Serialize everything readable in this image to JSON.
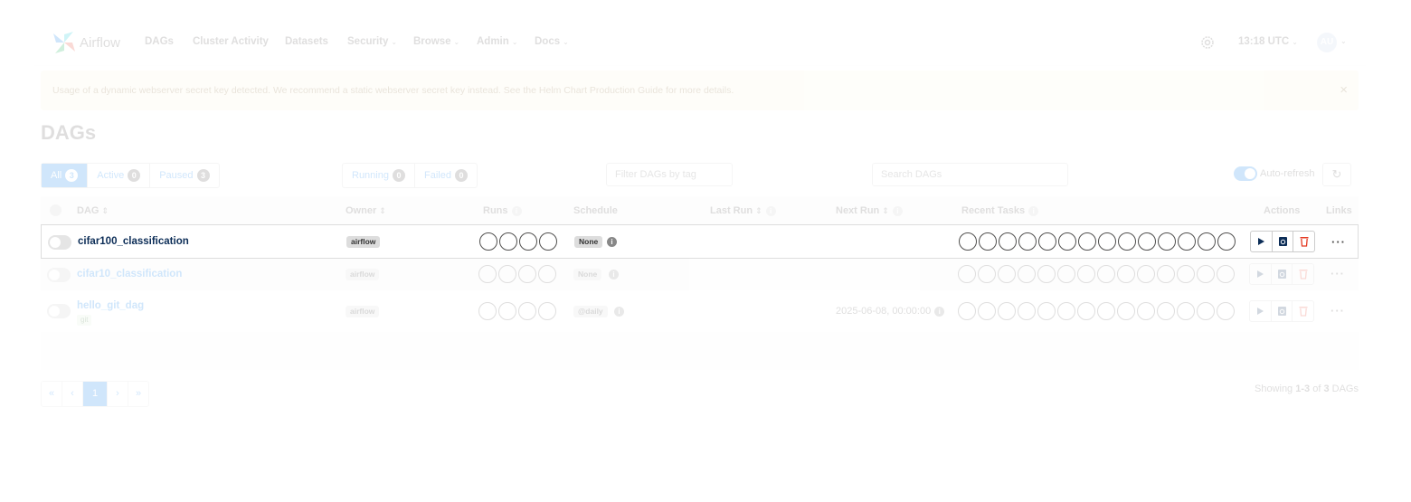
{
  "navbar": {
    "brand": "Airflow",
    "items": [
      {
        "label": "DAGs",
        "dropdown": false
      },
      {
        "label": "Cluster Activity",
        "dropdown": false
      },
      {
        "label": "Datasets",
        "dropdown": false
      },
      {
        "label": "Security",
        "dropdown": true
      },
      {
        "label": "Browse",
        "dropdown": true
      },
      {
        "label": "Admin",
        "dropdown": true
      },
      {
        "label": "Docs",
        "dropdown": true
      }
    ],
    "time": "13:18 UTC",
    "avatar": "AU"
  },
  "alert": {
    "text": "Usage of a dynamic webserver secret key detected. We recommend a static webserver secret key instead. See the Helm Chart Production Guide for more details.",
    "close": "×"
  },
  "page_title": "DAGs",
  "filters": {
    "status": [
      {
        "label": "All",
        "count": "3"
      },
      {
        "label": "Active",
        "count": "0"
      },
      {
        "label": "Paused",
        "count": "3"
      }
    ],
    "runs": [
      {
        "label": "Running",
        "count": "0"
      },
      {
        "label": "Failed",
        "count": "0"
      }
    ],
    "tag_placeholder": "Filter DAGs by tag",
    "search_placeholder": "Search DAGs",
    "auto_refresh": "Auto-refresh",
    "refresh_icon": "↻"
  },
  "table": {
    "headers": {
      "dag": "DAG",
      "owner": "Owner",
      "runs": "Runs",
      "schedule": "Schedule",
      "last_run": "Last Run",
      "next_run": "Next Run",
      "recent_tasks": "Recent Tasks",
      "actions": "Actions",
      "links": "Links"
    },
    "rows": [
      {
        "dag_id": "cifar100_classification",
        "tag": "",
        "owner": "airflow",
        "schedule": "None",
        "next_run": ""
      },
      {
        "dag_id": "cifar10_classification",
        "tag": "",
        "owner": "airflow",
        "schedule": "None",
        "next_run": ""
      },
      {
        "dag_id": "hello_git_dag",
        "tag": "git",
        "owner": "airflow",
        "schedule": "@daily",
        "next_run": "2025-06-08, 00:00:00"
      }
    ],
    "links_label": "···"
  },
  "pagination": {
    "first": "«",
    "prev": "‹",
    "current": "1",
    "next": "›",
    "last": "»"
  },
  "showing": {
    "prefix": "Showing",
    "range": "1-3",
    "of": "of",
    "total": "3",
    "suffix": "DAGs"
  },
  "colors": {
    "accent": "#017cee",
    "alert_bg": "#fcf8e3",
    "text": "#51504f",
    "delete": "#e43921"
  }
}
